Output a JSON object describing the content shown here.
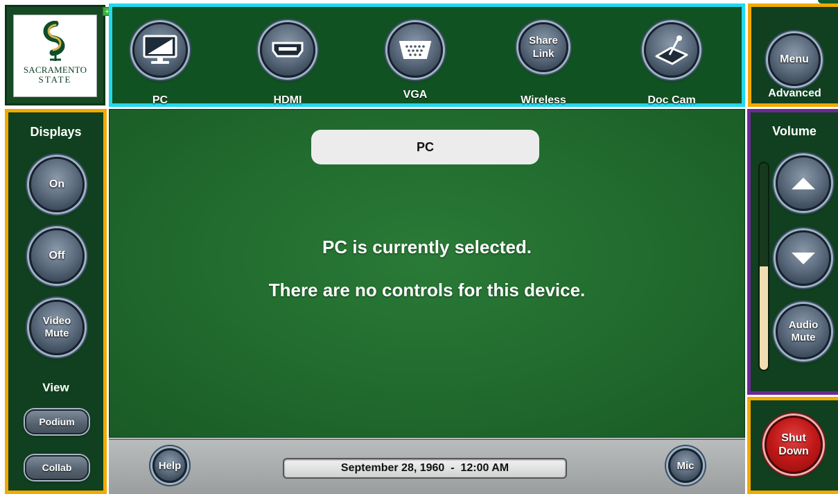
{
  "logo": {
    "line1": "SACRAMENTO",
    "line2": "STATE",
    "badge": "+"
  },
  "sources": [
    {
      "label": "PC",
      "icon": "monitor-icon"
    },
    {
      "label": "HDMI",
      "icon": "hdmi-port-icon"
    },
    {
      "label": "VGA",
      "icon": "vga-port-icon"
    },
    {
      "label": "Wireless",
      "inside_text": "Share Link"
    },
    {
      "label": "Doc Cam",
      "icon": "document-camera-icon"
    }
  ],
  "advanced": {
    "menu_label": "Menu",
    "label": "Advanced"
  },
  "displays": {
    "title": "Displays",
    "on_label": "On",
    "off_label": "Off",
    "video_mute_label": "Video Mute",
    "view_title": "View",
    "podium_label": "Podium",
    "collab_label": "Collab"
  },
  "main": {
    "selected_source": "PC",
    "message_line1": "PC is currently selected.",
    "message_line2": "There are no controls for this device."
  },
  "bottom": {
    "help_label": "Help",
    "datetime": "September 28, 1960  -  12:00 AM",
    "mic_label": "Mic"
  },
  "volume": {
    "title": "Volume",
    "level_fraction": 0.5,
    "audio_mute_label": "Audio Mute"
  },
  "shutdown": {
    "label": "Shut Down"
  },
  "colors": {
    "panel_green": "#10401f",
    "accent_orange": "#f2a900",
    "accent_cyan": "#22d8ee",
    "accent_purple": "#6a2a93",
    "shutdown_red": "#c01818"
  }
}
